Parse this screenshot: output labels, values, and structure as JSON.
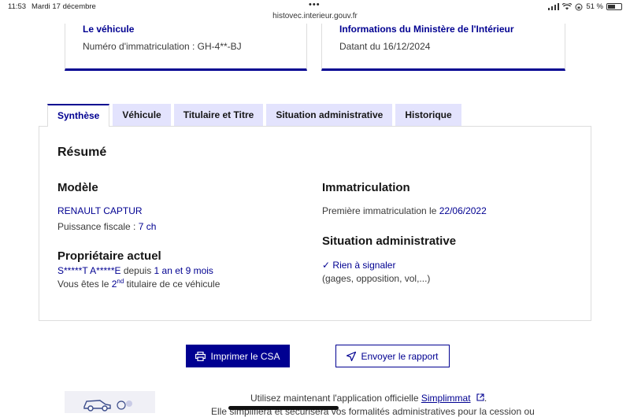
{
  "status_bar": {
    "time": "11:53",
    "date": "Mardi 17 décembre",
    "url": "histovec.interieur.gouv.fr",
    "battery": "51 %"
  },
  "vehicle_card": {
    "title": "Le véhicule",
    "registration": "Numéro d'immatriculation : GH-4**-BJ"
  },
  "ministry_card": {
    "title": "Informations du Ministère de l'Intérieur",
    "date": "Datant du 16/12/2024"
  },
  "tabs": [
    {
      "label": "Synthèse",
      "active": true
    },
    {
      "label": "Véhicule",
      "active": false
    },
    {
      "label": "Titulaire et Titre",
      "active": false
    },
    {
      "label": "Situation administrative",
      "active": false
    },
    {
      "label": "Historique",
      "active": false
    }
  ],
  "summary": {
    "title": "Résumé",
    "model": {
      "heading": "Modèle",
      "name": "RENAULT CAPTUR",
      "power_label": "Puissance fiscale : ",
      "power_value": "7 ch"
    },
    "owner": {
      "heading": "Propriétaire actuel",
      "name": "S*****T A*****E",
      "since_label": " depuis ",
      "since_value": "1 an et 9 mois",
      "rank_prefix": "Vous êtes le ",
      "rank_num": "2",
      "rank_sup": "nd",
      "rank_suffix": " titulaire de ce véhicule"
    },
    "registration": {
      "heading": "Immatriculation",
      "first_label": "Première immatriculation le ",
      "first_date": "22/06/2022"
    },
    "admin": {
      "heading": "Situation administrative",
      "status": "Rien à signaler",
      "details": "(gages, opposition, vol,...)"
    }
  },
  "actions": {
    "print_label": "Imprimer le CSA",
    "send_label": "Envoyer le rapport"
  },
  "promo": {
    "line1_prefix": "Utilisez maintenant l'application officielle ",
    "line1_link": "Simplimmat",
    "line1_suffix": ".",
    "line2": "Elle simplifiera et sécurisera vos formalités administratives pour la cession ou"
  },
  "colors": {
    "accent": "#000091",
    "tab_bg": "#e3e3fd",
    "text": "#3a3a3a"
  }
}
